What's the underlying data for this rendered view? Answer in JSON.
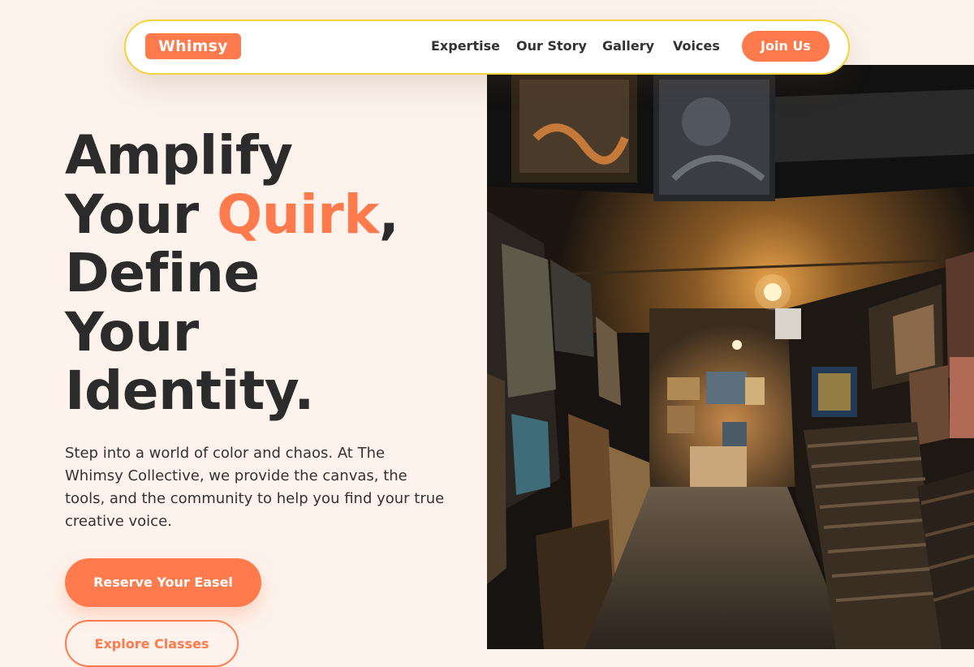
{
  "brand": {
    "logo": "Whimsy"
  },
  "nav": {
    "links": [
      "Expertise",
      "Our Story",
      "Gallery",
      "Voices"
    ],
    "cta": "Join Us"
  },
  "hero": {
    "line1": "Amplify",
    "line2_pre": "Your ",
    "line2_accent": "Quirk",
    "line2_post": ",",
    "line3": "Define",
    "line4": "Your",
    "line5": "Identity.",
    "lede": "Step into a world of color and chaos. At The Whimsy Collective, we provide the canvas, the tools, and the community to help you find your true creative voice.",
    "primary_cta": "Reserve Your Easel",
    "secondary_cta": "Explore Classes"
  },
  "colors": {
    "accent": "#ff7a4c",
    "background": "#fdf3ec",
    "nav_border": "#f2d43b",
    "text": "#2b2b2b"
  },
  "image": {
    "subject": "art-gallery-corridor-photo"
  }
}
